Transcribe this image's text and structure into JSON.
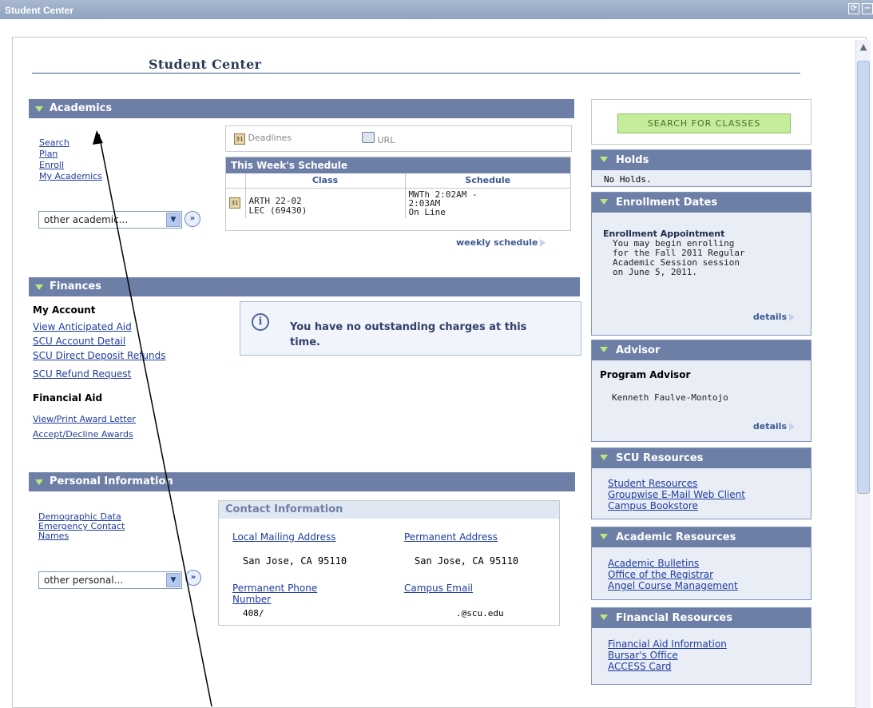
{
  "window": {
    "title": "Student Center",
    "refresh_icon": "refresh-icon",
    "collapse_icon": "minimize-icon"
  },
  "page": {
    "title": "Student Center"
  },
  "academics": {
    "header": "Academics",
    "links": [
      "Search",
      "Plan",
      "Enroll",
      "My Academics"
    ],
    "dropdown_value": "other academic...",
    "deadlines_label": "Deadlines",
    "url_label": "URL",
    "schedule": {
      "title": "This Week's Schedule",
      "col_class": "Class",
      "col_schedule": "Schedule",
      "rows": [
        {
          "class_line1": "ARTH 22-02",
          "class_line2": "LEC (69430)",
          "sched_line1": "MWTh 2:02AM -",
          "sched_line2": "2:03AM",
          "sched_line3": "On Line"
        }
      ]
    },
    "weekly_link": "weekly schedule"
  },
  "finances": {
    "header": "Finances",
    "my_account_label": "My Account",
    "account_links": [
      "View Anticipated Aid",
      "SCU Account Detail",
      "SCU Direct Deposit Refunds",
      "SCU Refund Request"
    ],
    "financial_aid_label": "Financial Aid",
    "aid_links": [
      "View/Print Award Letter",
      "Accept/Decline Awards"
    ],
    "message_line1": "You have no outstanding charges at this",
    "message_line2": "time."
  },
  "personal": {
    "header": "Personal Information",
    "links": [
      "Demographic Data",
      "Emergency Contact",
      "Names"
    ],
    "dropdown_value": "other personal...",
    "contact": {
      "title": "Contact Information",
      "local_mailing_label": "Local Mailing Address",
      "local_mailing_value": "San Jose, CA 95110",
      "permanent_address_label": "Permanent Address",
      "permanent_address_value": "San Jose, CA 95110",
      "permanent_phone_label_1": "Permanent Phone",
      "permanent_phone_label_2": "Number",
      "permanent_phone_value": "408/",
      "campus_email_label": "Campus Email",
      "campus_email_value": ".@scu.edu"
    }
  },
  "sidebar": {
    "search_button": "SEARCH FOR CLASSES",
    "holds": {
      "header": "Holds",
      "text": "No Holds."
    },
    "enrollment": {
      "header": "Enrollment Dates",
      "appointment_label": "Enrollment Appointment",
      "lines": [
        "You may begin enrolling",
        "for the Fall 2011 Regular",
        "Academic Session session",
        "on June 5, 2011."
      ],
      "details": "details"
    },
    "advisor": {
      "header": "Advisor",
      "label": "Program Advisor",
      "name": "Kenneth Faulve-Montojo",
      "details": "details"
    },
    "scu_resources": {
      "header": "SCU Resources",
      "links": [
        "Student Resources",
        "Groupwise E-Mail Web Client",
        "Campus Bookstore"
      ]
    },
    "academic_resources": {
      "header": "Academic Resources",
      "links": [
        "Academic Bulletins",
        "Office of the Registrar",
        "Angel Course Management"
      ]
    },
    "financial_resources": {
      "header": "Financial Resources",
      "links": [
        "Financial Aid Information",
        "Bursar's Office",
        "ACCESS Card"
      ]
    }
  }
}
